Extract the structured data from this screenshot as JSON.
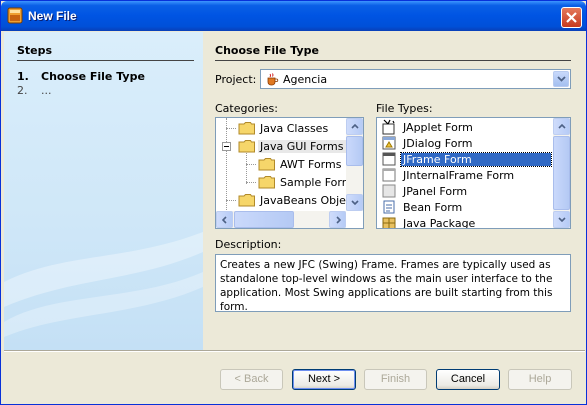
{
  "window": {
    "title": "New File"
  },
  "steps": {
    "title": "Steps",
    "items": [
      {
        "num": "1.",
        "label": "Choose File Type"
      },
      {
        "num": "2.",
        "label": "..."
      }
    ]
  },
  "main": {
    "title": "Choose File Type",
    "project": {
      "label": "Project:",
      "value": "Agencia"
    },
    "categories": {
      "label": "Categories:",
      "items": [
        "Java Classes",
        "Java GUI Forms",
        "AWT Forms",
        "Sample Forms",
        "JavaBeans Object"
      ]
    },
    "file_types": {
      "label": "File Types:",
      "items": [
        "JApplet Form",
        "JDialog Form",
        "JFrame Form",
        "JInternalFrame Form",
        "JPanel Form",
        "Bean Form",
        "Java Package"
      ],
      "selected": "JFrame Form"
    },
    "description": {
      "label": "Description:",
      "text": "Creates a new JFC (Swing) Frame. Frames are typically used as standalone top-level windows as the main user interface to the application. Most Swing applications are built starting from this form."
    }
  },
  "buttons": {
    "back": "< Back",
    "next": "Next >",
    "finish": "Finish",
    "cancel": "Cancel",
    "help": "Help"
  }
}
